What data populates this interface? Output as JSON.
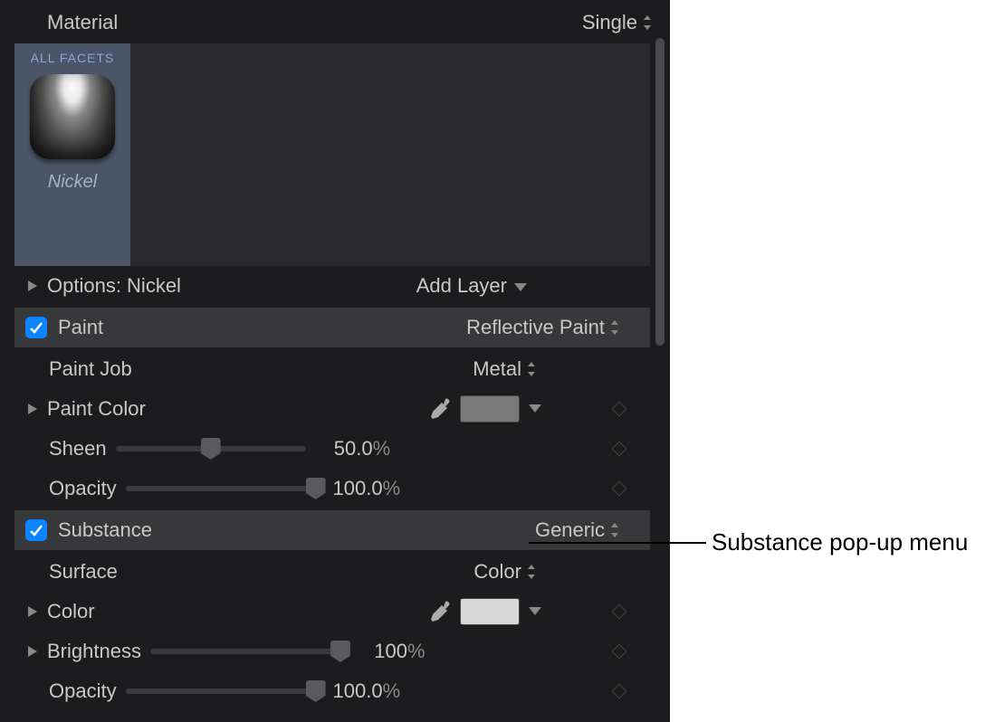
{
  "header": {
    "material_label": "Material",
    "type_value": "Single"
  },
  "facets": {
    "tab_label": "ALL FACETS",
    "material_name": "Nickel"
  },
  "options": {
    "label": "Options: Nickel",
    "add_layer_label": "Add Layer"
  },
  "paint": {
    "section_label": "Paint",
    "type_value": "Reflective Paint",
    "paint_job": {
      "label": "Paint Job",
      "value": "Metal"
    },
    "paint_color": {
      "label": "Paint Color",
      "swatch": "#7a7a7a"
    },
    "sheen": {
      "label": "Sheen",
      "value": "50.0",
      "unit": "%",
      "pos": 50
    },
    "opacity": {
      "label": "Opacity",
      "value": "100.0",
      "unit": "%",
      "pos": 100
    }
  },
  "substance": {
    "section_label": "Substance",
    "type_value": "Generic",
    "surface": {
      "label": "Surface",
      "value": "Color"
    },
    "color": {
      "label": "Color",
      "swatch": "#d8d8d8"
    },
    "brightness": {
      "label": "Brightness",
      "value": "100",
      "unit": "%",
      "pos": 100
    },
    "opacity": {
      "label": "Opacity",
      "value": "100.0",
      "unit": "%",
      "pos": 100
    }
  },
  "callout": "Substance pop-up menu"
}
